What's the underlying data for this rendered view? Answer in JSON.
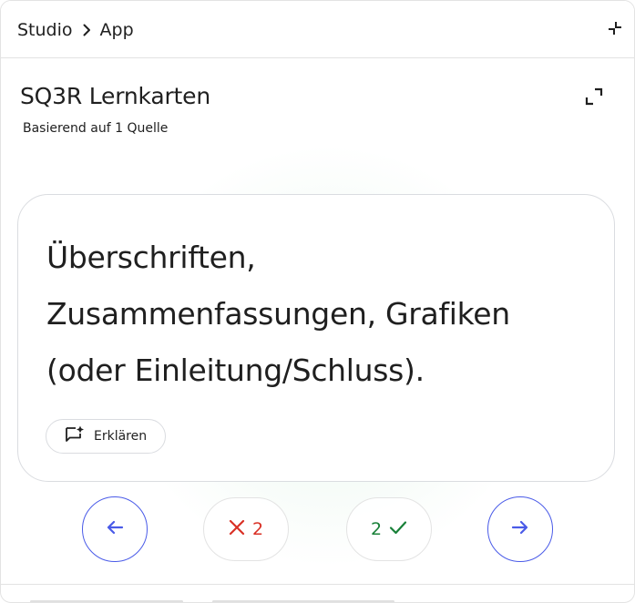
{
  "breadcrumb": {
    "root": "Studio",
    "current": "App"
  },
  "header": {
    "title": "SQ3R Lernkarten",
    "subtitle": "Basierend auf 1 Quelle"
  },
  "flashcard": {
    "text": "Überschriften, Zusammenfassungen, Grafiken (oder Einleitung/Schluss).",
    "explain_label": "Erklären"
  },
  "controls": {
    "wrong_count": "2",
    "right_count": "2"
  },
  "icons": {
    "collapse": "collapse-icon",
    "expand": "expand-icon",
    "prev": "arrow-left-icon",
    "next": "arrow-right-icon",
    "wrong": "close-icon",
    "right": "check-icon",
    "explain": "chat-sparkle-icon"
  },
  "colors": {
    "accent": "#4a5be8",
    "wrong": "#d93025",
    "right": "#188038",
    "border": "#dadce0"
  }
}
